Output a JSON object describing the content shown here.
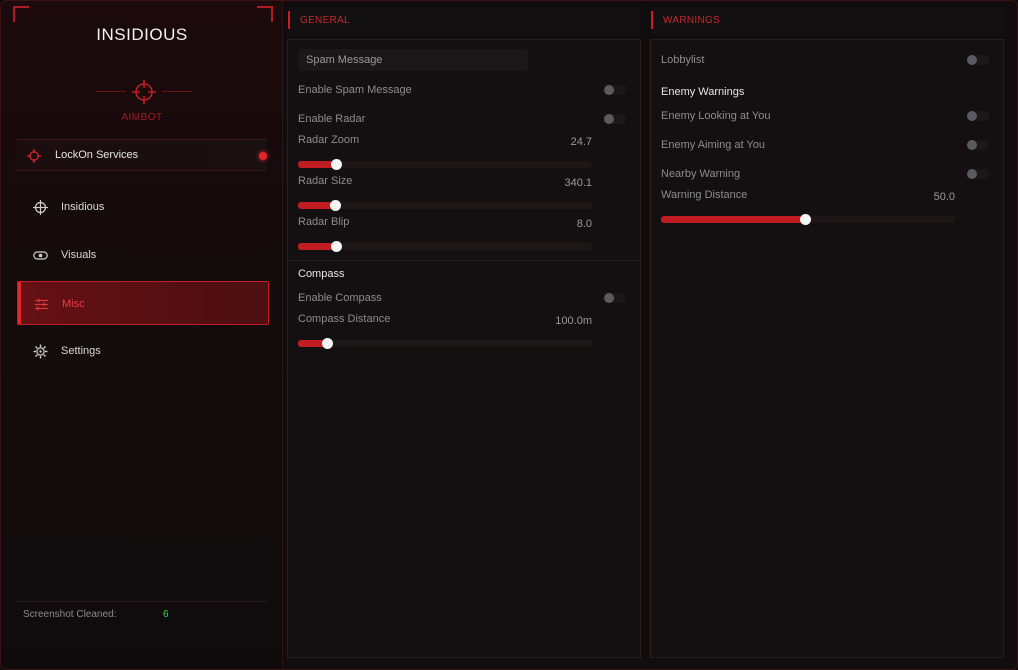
{
  "brand": {
    "title": "INSIDIOUS",
    "badge_label": "AIMBOT"
  },
  "sidebar": {
    "service": {
      "label": "LockOn Services",
      "icon": "crosshair-icon",
      "status_color": "#e5262c"
    },
    "items": [
      {
        "label": "Insidious",
        "icon": "crosshair-icon"
      },
      {
        "label": "Visuals",
        "icon": "eye-icon"
      },
      {
        "label": "Misc",
        "icon": "sliders-icon",
        "active": true
      },
      {
        "label": "Settings",
        "icon": "gear-icon"
      }
    ],
    "footer": {
      "label": "Screenshot Cleaned:",
      "count": "6"
    }
  },
  "general": {
    "title": "GENERAL",
    "spam_input": {
      "value": "Spam Message"
    },
    "enable_spam": {
      "label": "Enable Spam Message",
      "on": false
    },
    "enable_radar": {
      "label": "Enable Radar",
      "on": false
    },
    "radar_zoom": {
      "label": "Radar Zoom",
      "value": "24.7",
      "fill": 0.13
    },
    "radar_size": {
      "label": "Radar Size",
      "value": "340.1",
      "fill": 0.125
    },
    "radar_blip": {
      "label": "Radar Blip",
      "value": "8.0",
      "fill": 0.13
    },
    "compass_section": "Compass",
    "enable_compass": {
      "label": "Enable Compass",
      "on": false
    },
    "compass_distance": {
      "label": "Compass Distance",
      "value": "100.0m",
      "fill": 0.1
    }
  },
  "warnings": {
    "title": "WARNINGS",
    "lobbylist": {
      "label": "Lobbylist",
      "on": false
    },
    "section": "Enemy Warnings",
    "enemy_looking": {
      "label": "Enemy Looking at You",
      "on": false
    },
    "enemy_aiming": {
      "label": "Enemy Aiming at You",
      "on": false
    },
    "nearby": {
      "label": "Nearby Warning",
      "on": false
    },
    "warning_distance": {
      "label": "Warning Distance",
      "value": "50.0",
      "fill": 0.49
    }
  },
  "colors": {
    "accent": "#c81e24",
    "active_bg": "#5a1013",
    "success": "#3fd24a"
  }
}
